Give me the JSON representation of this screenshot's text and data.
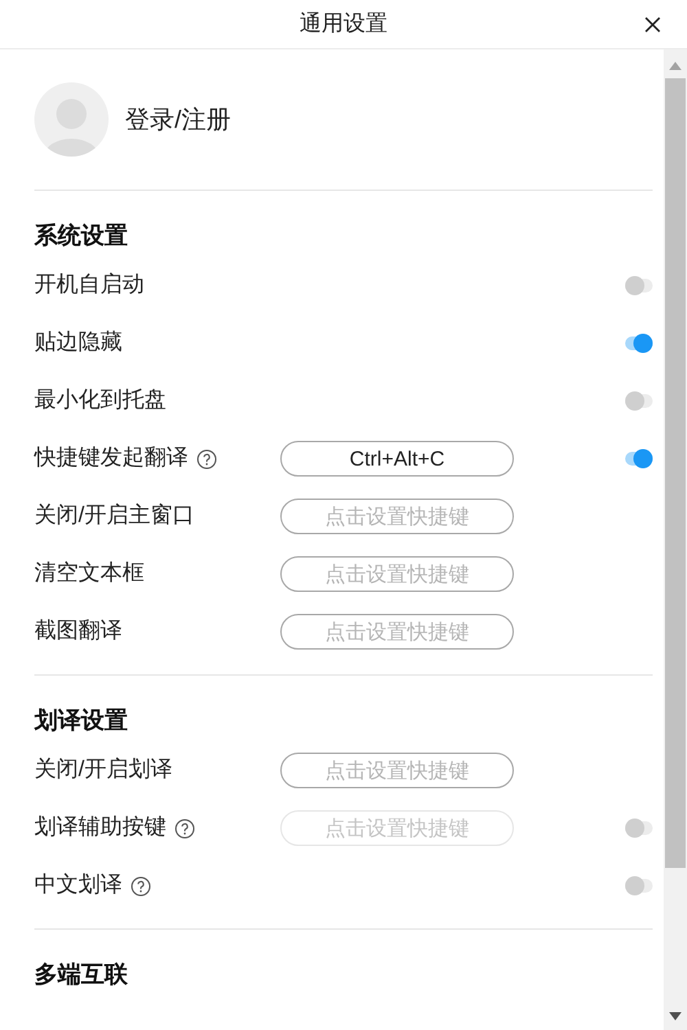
{
  "window": {
    "title": "通用设置"
  },
  "account": {
    "label": "登录/注册"
  },
  "sections": [
    {
      "title": "系统设置",
      "rows": [
        {
          "kind": "toggle",
          "label": "开机自启动",
          "help": false,
          "on": false
        },
        {
          "kind": "toggle",
          "label": "贴边隐藏",
          "help": false,
          "on": true
        },
        {
          "kind": "toggle",
          "label": "最小化到托盘",
          "help": false,
          "on": false
        },
        {
          "kind": "shortcut_toggle",
          "label": "快捷键发起翻译",
          "help": true,
          "value": "Ctrl+Alt+C",
          "disabled": false,
          "on": true
        },
        {
          "kind": "shortcut",
          "label": "关闭/开启主窗口",
          "help": false,
          "placeholder": "点击设置快捷键",
          "disabled": false
        },
        {
          "kind": "shortcut",
          "label": "清空文本框",
          "help": false,
          "placeholder": "点击设置快捷键",
          "disabled": false
        },
        {
          "kind": "shortcut",
          "label": "截图翻译",
          "help": false,
          "placeholder": "点击设置快捷键",
          "disabled": false
        }
      ]
    },
    {
      "title": "划译设置",
      "rows": [
        {
          "kind": "shortcut",
          "label": "关闭/开启划译",
          "help": false,
          "placeholder": "点击设置快捷键",
          "disabled": false
        },
        {
          "kind": "shortcut_toggle",
          "label": "划译辅助按键",
          "help": true,
          "placeholder": "点击设置快捷键",
          "disabled": true,
          "on": false
        },
        {
          "kind": "toggle",
          "label": "中文划译",
          "help": true,
          "on": false
        }
      ]
    },
    {
      "title": "多端互联"
    }
  ]
}
